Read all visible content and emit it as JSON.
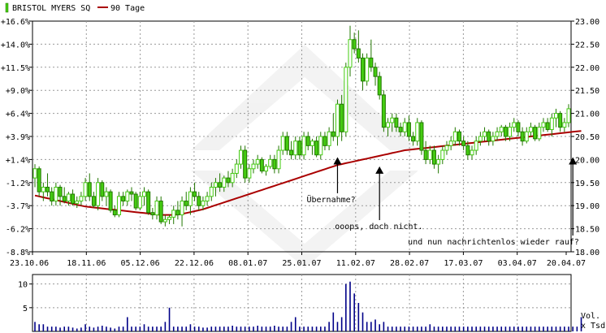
{
  "chart_data": {
    "type": "candlestick",
    "legend": {
      "items": [
        {
          "name": "BRISTOL MYERS SQ",
          "color": "#44cc11",
          "swatch": "candle"
        },
        {
          "name": "90 Tage",
          "color": "#aa0000",
          "swatch": "line"
        }
      ]
    },
    "price_axis": {
      "ticks": [
        "18.00",
        "18.50",
        "19.00",
        "19.50",
        "20.00",
        "20.50",
        "21.00",
        "21.50",
        "22.00",
        "22.50",
        "23.00"
      ],
      "ylim": [
        18.0,
        23.0
      ]
    },
    "percent_axis": {
      "ticks": [
        "-8.8%",
        "-6.2%",
        "-3.7%",
        "-1.2%",
        "+1.4%",
        "+3.9%",
        "+6.4%",
        "+9.0%",
        "+11.5%",
        "+14.0%",
        "+16.6%"
      ]
    },
    "date_axis": {
      "ticks": [
        "23.10.06",
        "18.11.06",
        "05.12.06",
        "22.12.06",
        "08.01.07",
        "25.01.07",
        "11.02.07",
        "28.02.07",
        "17.03.07",
        "03.04.07",
        "20.04.07"
      ]
    },
    "volume_axis": {
      "ticks": [
        "5",
        "10"
      ],
      "ylim": [
        0,
        12
      ],
      "label_line1": "Vol.",
      "label_line2": "x Tsd"
    },
    "annotations": [
      {
        "text": "Übernahme?",
        "x_index": 72,
        "price": 20.05
      },
      {
        "text": "ooops, doch nicht.",
        "x_index": 82,
        "price": 19.85
      },
      {
        "text": "und nun nachrichtenlos wieder rauf?",
        "x_index": 128,
        "price": 20.05
      }
    ],
    "colors": {
      "up": "#44cc11",
      "down": "#44cc11",
      "ma": "#aa0000",
      "volume": "#000088",
      "grid": "#999999"
    },
    "candles": [
      [
        19.6,
        19.9,
        19.4,
        19.8
      ],
      [
        19.8,
        19.85,
        19.2,
        19.3
      ],
      [
        19.3,
        19.5,
        19.1,
        19.4
      ],
      [
        19.4,
        19.7,
        19.2,
        19.3
      ],
      [
        19.3,
        19.4,
        19.0,
        19.1
      ],
      [
        19.1,
        19.5,
        19.0,
        19.4
      ],
      [
        19.4,
        19.45,
        19.0,
        19.2
      ],
      [
        19.2,
        19.4,
        19.05,
        19.1
      ],
      [
        19.1,
        19.3,
        19.0,
        19.25
      ],
      [
        19.25,
        19.35,
        19.0,
        19.05
      ],
      [
        19.05,
        19.2,
        18.95,
        19.1
      ],
      [
        19.1,
        19.3,
        19.0,
        19.2
      ],
      [
        19.2,
        19.6,
        19.1,
        19.5
      ],
      [
        19.5,
        19.7,
        19.1,
        19.2
      ],
      [
        19.2,
        19.3,
        18.95,
        19.0
      ],
      [
        19.0,
        19.6,
        18.9,
        19.5
      ],
      [
        19.5,
        19.55,
        19.1,
        19.2
      ],
      [
        19.2,
        19.4,
        19.0,
        19.3
      ],
      [
        19.3,
        19.35,
        18.85,
        18.9
      ],
      [
        18.9,
        19.0,
        18.75,
        18.8
      ],
      [
        18.8,
        19.3,
        18.75,
        19.2
      ],
      [
        19.2,
        19.3,
        19.0,
        19.1
      ],
      [
        19.1,
        19.35,
        19.0,
        19.3
      ],
      [
        19.3,
        19.4,
        19.1,
        19.25
      ],
      [
        19.25,
        19.3,
        18.9,
        18.95
      ],
      [
        18.95,
        19.3,
        18.9,
        19.2
      ],
      [
        19.2,
        19.4,
        19.0,
        19.3
      ],
      [
        19.3,
        19.35,
        18.8,
        18.85
      ],
      [
        18.85,
        18.95,
        18.7,
        18.8
      ],
      [
        18.8,
        19.2,
        18.7,
        19.1
      ],
      [
        19.1,
        19.2,
        18.6,
        18.65
      ],
      [
        18.65,
        18.8,
        18.55,
        18.7
      ],
      [
        18.7,
        18.8,
        18.6,
        18.75
      ],
      [
        18.75,
        19.0,
        18.6,
        18.9
      ],
      [
        18.9,
        19.1,
        18.7,
        18.8
      ],
      [
        18.8,
        19.2,
        18.55,
        19.1
      ],
      [
        19.1,
        19.3,
        18.9,
        19.0
      ],
      [
        19.0,
        19.4,
        18.8,
        19.3
      ],
      [
        19.3,
        19.5,
        19.1,
        19.2
      ],
      [
        19.2,
        19.3,
        18.9,
        19.0
      ],
      [
        19.0,
        19.2,
        18.9,
        19.1
      ],
      [
        19.1,
        19.3,
        19.0,
        19.2
      ],
      [
        19.2,
        19.5,
        19.1,
        19.4
      ],
      [
        19.4,
        19.6,
        19.2,
        19.5
      ],
      [
        19.5,
        19.7,
        19.3,
        19.4
      ],
      [
        19.4,
        19.65,
        19.3,
        19.6
      ],
      [
        19.6,
        19.75,
        19.4,
        19.5
      ],
      [
        19.5,
        19.8,
        19.4,
        19.7
      ],
      [
        19.7,
        20.0,
        19.6,
        19.9
      ],
      [
        19.9,
        20.3,
        19.8,
        20.2
      ],
      [
        20.2,
        20.3,
        19.5,
        19.6
      ],
      [
        19.6,
        19.9,
        19.5,
        19.8
      ],
      [
        19.8,
        20.0,
        19.7,
        19.9
      ],
      [
        19.9,
        20.1,
        19.8,
        20.0
      ],
      [
        20.0,
        20.05,
        19.7,
        19.75
      ],
      [
        19.75,
        19.9,
        19.65,
        19.85
      ],
      [
        19.85,
        20.1,
        19.8,
        20.0
      ],
      [
        20.0,
        20.1,
        19.7,
        19.8
      ],
      [
        19.8,
        20.3,
        19.7,
        20.2
      ],
      [
        20.2,
        20.6,
        20.1,
        20.5
      ],
      [
        20.5,
        20.6,
        20.1,
        20.2
      ],
      [
        20.2,
        20.4,
        20.0,
        20.1
      ],
      [
        20.1,
        20.5,
        20.0,
        20.4
      ],
      [
        20.4,
        20.5,
        20.0,
        20.1
      ],
      [
        20.1,
        20.6,
        20.0,
        20.5
      ],
      [
        20.5,
        20.6,
        20.2,
        20.3
      ],
      [
        20.3,
        20.45,
        20.1,
        20.4
      ],
      [
        20.4,
        20.5,
        20.05,
        20.1
      ],
      [
        20.1,
        20.6,
        20.0,
        20.5
      ],
      [
        20.5,
        20.6,
        20.2,
        20.3
      ],
      [
        20.3,
        20.7,
        20.2,
        20.6
      ],
      [
        20.6,
        21.0,
        20.4,
        20.5
      ],
      [
        20.5,
        21.3,
        20.3,
        21.2
      ],
      [
        21.2,
        21.4,
        20.4,
        20.6
      ],
      [
        20.6,
        22.1,
        20.5,
        22.0
      ],
      [
        22.0,
        22.9,
        21.8,
        22.6
      ],
      [
        22.6,
        22.75,
        22.3,
        22.4
      ],
      [
        22.4,
        22.8,
        22.1,
        22.2
      ],
      [
        22.2,
        22.3,
        21.5,
        21.7
      ],
      [
        21.7,
        22.3,
        21.6,
        22.2
      ],
      [
        22.2,
        22.6,
        21.9,
        22.0
      ],
      [
        22.0,
        22.1,
        21.6,
        21.8
      ],
      [
        21.8,
        21.9,
        21.3,
        21.4
      ],
      [
        21.4,
        21.5,
        20.6,
        20.7
      ],
      [
        20.7,
        20.9,
        20.5,
        20.8
      ],
      [
        20.8,
        21.0,
        20.6,
        20.9
      ],
      [
        20.9,
        21.0,
        20.6,
        20.7
      ],
      [
        20.7,
        20.8,
        20.5,
        20.6
      ],
      [
        20.6,
        20.9,
        20.5,
        20.8
      ],
      [
        20.8,
        20.95,
        20.4,
        20.5
      ],
      [
        20.5,
        20.6,
        20.3,
        20.4
      ],
      [
        20.4,
        20.9,
        20.3,
        20.8
      ],
      [
        20.8,
        20.85,
        20.1,
        20.2
      ],
      [
        20.2,
        20.4,
        19.9,
        20.0
      ],
      [
        20.0,
        20.3,
        19.9,
        20.2
      ],
      [
        20.2,
        20.3,
        19.8,
        19.9
      ],
      [
        19.9,
        20.1,
        19.7,
        20.0
      ],
      [
        20.0,
        20.3,
        19.9,
        20.2
      ],
      [
        20.2,
        20.4,
        20.1,
        20.3
      ],
      [
        20.3,
        20.5,
        20.2,
        20.4
      ],
      [
        20.4,
        20.7,
        20.3,
        20.6
      ],
      [
        20.6,
        20.65,
        20.3,
        20.4
      ],
      [
        20.4,
        20.5,
        20.2,
        20.3
      ],
      [
        20.3,
        20.4,
        20.0,
        20.1
      ],
      [
        20.1,
        20.3,
        20.0,
        20.2
      ],
      [
        20.2,
        20.5,
        20.1,
        20.4
      ],
      [
        20.4,
        20.6,
        20.3,
        20.5
      ],
      [
        20.5,
        20.7,
        20.4,
        20.6
      ],
      [
        20.6,
        20.65,
        20.3,
        20.4
      ],
      [
        20.4,
        20.6,
        20.3,
        20.5
      ],
      [
        20.5,
        20.7,
        20.4,
        20.6
      ],
      [
        20.6,
        20.75,
        20.5,
        20.7
      ],
      [
        20.7,
        20.75,
        20.4,
        20.5
      ],
      [
        20.5,
        20.8,
        20.4,
        20.7
      ],
      [
        20.7,
        20.9,
        20.6,
        20.8
      ],
      [
        20.8,
        20.85,
        20.5,
        20.6
      ],
      [
        20.6,
        20.7,
        20.3,
        20.4
      ],
      [
        20.4,
        20.7,
        20.35,
        20.6
      ],
      [
        20.6,
        20.8,
        20.5,
        20.7
      ],
      [
        20.7,
        20.75,
        20.4,
        20.45
      ],
      [
        20.45,
        20.8,
        20.4,
        20.7
      ],
      [
        20.7,
        20.9,
        20.6,
        20.8
      ],
      [
        20.8,
        20.9,
        20.6,
        20.65
      ],
      [
        20.65,
        21.0,
        20.5,
        20.9
      ],
      [
        20.9,
        21.1,
        20.7,
        21.0
      ],
      [
        21.0,
        21.05,
        20.6,
        20.7
      ],
      [
        20.7,
        20.9,
        20.6,
        20.8
      ],
      [
        20.8,
        21.2,
        20.7,
        21.1
      ]
    ],
    "ma90": [
      19.22,
      19.2,
      19.18,
      19.16,
      19.14,
      19.12,
      19.1,
      19.08,
      19.06,
      19.04,
      19.02,
      19.0,
      18.98,
      18.97,
      18.96,
      18.95,
      18.94,
      18.93,
      18.92,
      18.91,
      18.9,
      18.89,
      18.88,
      18.87,
      18.86,
      18.85,
      18.84,
      18.83,
      18.82,
      18.81,
      18.8,
      18.8,
      18.8,
      18.8,
      18.81,
      18.82,
      18.84,
      18.86,
      18.88,
      18.9,
      18.92,
      18.95,
      18.98,
      19.01,
      19.04,
      19.07,
      19.1,
      19.13,
      19.16,
      19.19,
      19.22,
      19.25,
      19.28,
      19.31,
      19.34,
      19.37,
      19.4,
      19.43,
      19.46,
      19.49,
      19.52,
      19.55,
      19.58,
      19.61,
      19.64,
      19.67,
      19.7,
      19.73,
      19.76,
      19.79,
      19.82,
      19.85,
      19.88,
      19.9,
      19.92,
      19.94,
      19.96,
      19.98,
      20.0,
      20.02,
      20.04,
      20.06,
      20.08,
      20.1,
      20.12,
      20.14,
      20.16,
      20.18,
      20.2,
      20.21,
      20.22,
      20.23,
      20.24,
      20.25,
      20.26,
      20.27,
      20.28,
      20.29,
      20.3,
      20.31,
      20.32,
      20.33,
      20.34,
      20.35,
      20.36,
      20.37,
      20.38,
      20.39,
      20.4,
      20.41,
      20.42,
      20.43,
      20.44,
      20.45,
      20.46,
      20.47,
      20.48,
      20.49,
      20.5,
      20.51,
      20.52,
      20.53,
      20.54,
      20.55,
      20.56,
      20.57,
      20.58,
      20.59,
      20.6,
      20.61,
      20.62
    ],
    "volume": [
      2,
      1.5,
      1.5,
      1,
      1,
      1,
      0.8,
      1,
      1,
      0.8,
      0.6,
      0.8,
      1.5,
      1,
      0.8,
      1,
      1.2,
      1,
      0.8,
      0.6,
      1,
      1,
      3,
      1,
      1,
      1,
      1.5,
      1,
      1,
      1,
      1,
      2,
      5,
      1,
      1,
      1,
      1,
      1.5,
      1,
      1,
      0.8,
      0.8,
      1,
      1,
      1,
      1,
      1,
      1.2,
      1,
      1,
      1,
      1,
      1,
      1.2,
      1,
      1,
      1,
      1.2,
      1,
      1,
      1,
      2,
      3,
      1,
      1,
      1,
      1,
      1,
      1,
      1,
      2,
      4,
      2,
      3,
      10,
      10.5,
      8,
      6,
      4,
      2,
      2,
      2.5,
      1.5,
      2,
      1,
      1,
      1,
      1,
      1,
      1,
      1,
      1,
      1,
      1,
      1.5,
      1,
      1,
      1,
      1,
      1,
      1,
      1,
      1,
      1,
      1,
      1,
      1,
      1,
      1,
      1,
      1,
      1,
      1,
      1,
      1,
      1,
      1,
      1,
      1,
      1,
      1,
      1,
      1,
      1,
      1,
      1,
      1,
      1,
      1,
      1,
      3
    ]
  }
}
